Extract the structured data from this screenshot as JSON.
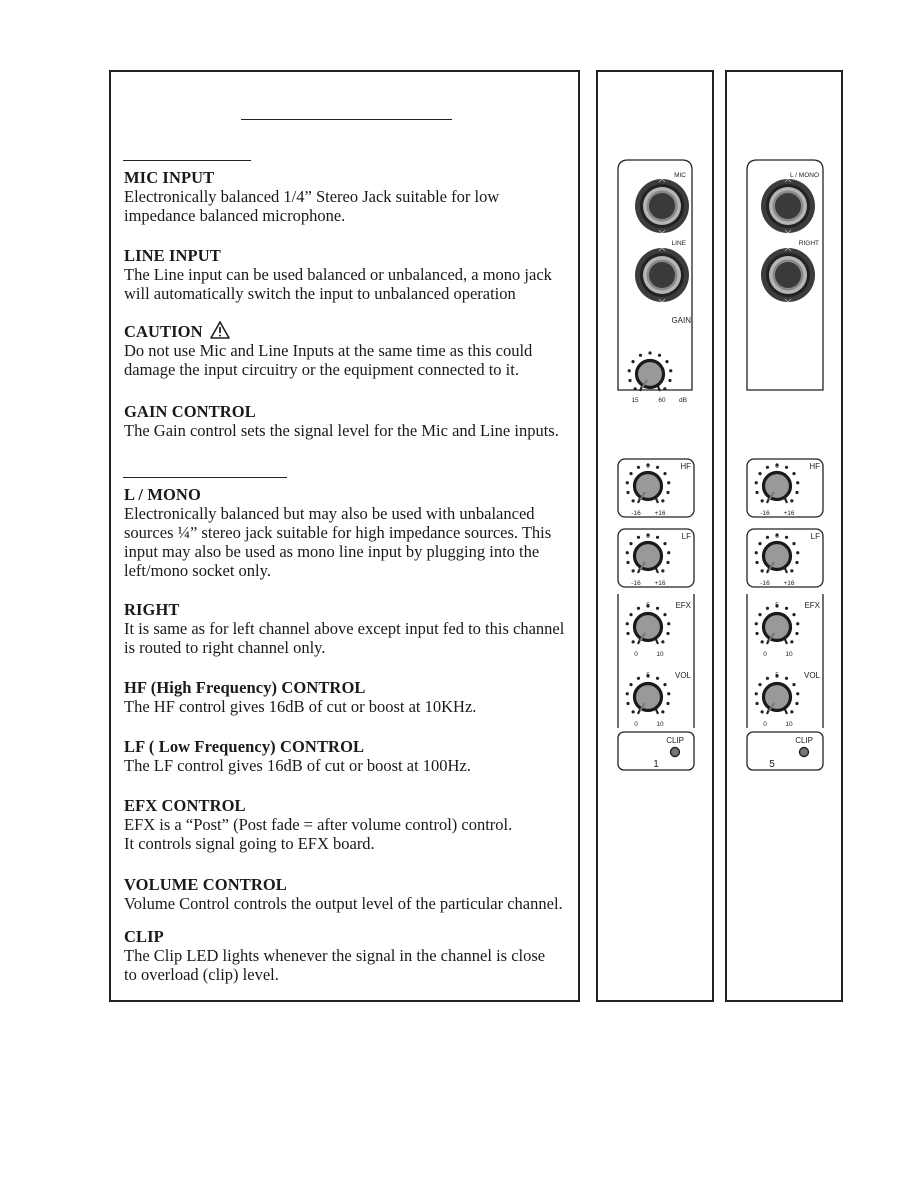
{
  "document": {
    "sections": [
      {
        "heading": "MIC INPUT",
        "lines": [
          "Electronically balanced 1/4” Stereo Jack suitable for low",
          "impedance balanced microphone."
        ]
      },
      {
        "heading": "LINE INPUT",
        "lines": [
          "The Line input can be used balanced or unbalanced, a mono jack",
          "will automatically switch the input to unbalanced operation"
        ]
      },
      {
        "heading": "CAUTION",
        "icon": "warning-triangle-icon",
        "lines": [
          "Do not use Mic and Line Inputs at the same time as this could",
          "damage the input circuitry or the equipment connected to it."
        ]
      },
      {
        "heading": "GAIN CONTROL",
        "lines": [
          "The Gain control sets the signal level for the Mic and Line inputs."
        ]
      },
      {
        "heading": "L / MONO",
        "lines": [
          "Electronically balanced but may also be used with unbalanced",
          "sources ¼” stereo jack suitable for high impedance sources. This",
          "input may also be used as mono line input by plugging into the",
          "left/mono socket only."
        ]
      },
      {
        "heading": "RIGHT",
        "lines": [
          "It is same as for left channel above except input fed to this channel",
          "is routed to right channel only."
        ]
      },
      {
        "heading": "HF (High Frequency) CONTROL",
        "lines": [
          "The HF control gives 16dB of cut or boost at 10KHz."
        ]
      },
      {
        "heading": "LF ( Low Frequency) CONTROL",
        "lines": [
          "The LF control gives 16dB of cut or boost at  100Hz."
        ]
      },
      {
        "heading": "EFX CONTROL",
        "lines": [
          "EFX is a “Post” (Post fade = after volume control) control.",
          "It controls signal going to EFX board."
        ]
      },
      {
        "heading": "VOLUME CONTROL",
        "lines": [
          "Volume Control controls the output level of the particular channel."
        ]
      },
      {
        "heading": "CLIP",
        "lines": [
          "The Clip LED lights whenever the signal in the channel is close",
          "to overload (clip) level."
        ]
      }
    ]
  },
  "mono_channel": {
    "jack1_label": "MIC",
    "jack2_label": "LINE",
    "gain": {
      "label": "GAIN",
      "min": "15",
      "max": "60",
      "unit": "dB"
    },
    "hf": {
      "label": "HF",
      "top": "0",
      "min": "-16",
      "max": "+16"
    },
    "lf": {
      "label": "LF",
      "top": "0",
      "min": "-16",
      "max": "+16"
    },
    "efx": {
      "label": "EFX",
      "top": "5",
      "min": "0",
      "max": "10"
    },
    "vol": {
      "label": "VOL",
      "top": "5",
      "min": "0",
      "max": "10"
    },
    "clip_label": "CLIP",
    "channel_number": "1"
  },
  "stereo_channel": {
    "jack1_label": "L / MONO",
    "jack2_label": "RIGHT",
    "hf": {
      "label": "HF",
      "top": "0",
      "min": "-16",
      "max": "+16"
    },
    "lf": {
      "label": "LF",
      "top": "0",
      "min": "-16",
      "max": "+16"
    },
    "efx": {
      "label": "EFX",
      "top": "5",
      "min": "0",
      "max": "10"
    },
    "vol": {
      "label": "VOL",
      "top": "5",
      "min": "0",
      "max": "10"
    },
    "clip_label": "CLIP",
    "channel_number": "5"
  }
}
